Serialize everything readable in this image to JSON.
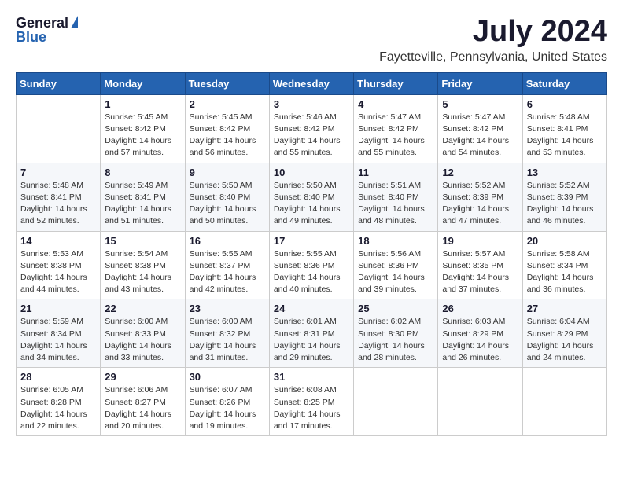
{
  "header": {
    "logo_general": "General",
    "logo_blue": "Blue",
    "month_year": "July 2024",
    "location": "Fayetteville, Pennsylvania, United States"
  },
  "weekdays": [
    "Sunday",
    "Monday",
    "Tuesday",
    "Wednesday",
    "Thursday",
    "Friday",
    "Saturday"
  ],
  "weeks": [
    [
      {
        "day": "",
        "detail": ""
      },
      {
        "day": "1",
        "detail": "Sunrise: 5:45 AM\nSunset: 8:42 PM\nDaylight: 14 hours\nand 57 minutes."
      },
      {
        "day": "2",
        "detail": "Sunrise: 5:45 AM\nSunset: 8:42 PM\nDaylight: 14 hours\nand 56 minutes."
      },
      {
        "day": "3",
        "detail": "Sunrise: 5:46 AM\nSunset: 8:42 PM\nDaylight: 14 hours\nand 55 minutes."
      },
      {
        "day": "4",
        "detail": "Sunrise: 5:47 AM\nSunset: 8:42 PM\nDaylight: 14 hours\nand 55 minutes."
      },
      {
        "day": "5",
        "detail": "Sunrise: 5:47 AM\nSunset: 8:42 PM\nDaylight: 14 hours\nand 54 minutes."
      },
      {
        "day": "6",
        "detail": "Sunrise: 5:48 AM\nSunset: 8:41 PM\nDaylight: 14 hours\nand 53 minutes."
      }
    ],
    [
      {
        "day": "7",
        "detail": "Sunrise: 5:48 AM\nSunset: 8:41 PM\nDaylight: 14 hours\nand 52 minutes."
      },
      {
        "day": "8",
        "detail": "Sunrise: 5:49 AM\nSunset: 8:41 PM\nDaylight: 14 hours\nand 51 minutes."
      },
      {
        "day": "9",
        "detail": "Sunrise: 5:50 AM\nSunset: 8:40 PM\nDaylight: 14 hours\nand 50 minutes."
      },
      {
        "day": "10",
        "detail": "Sunrise: 5:50 AM\nSunset: 8:40 PM\nDaylight: 14 hours\nand 49 minutes."
      },
      {
        "day": "11",
        "detail": "Sunrise: 5:51 AM\nSunset: 8:40 PM\nDaylight: 14 hours\nand 48 minutes."
      },
      {
        "day": "12",
        "detail": "Sunrise: 5:52 AM\nSunset: 8:39 PM\nDaylight: 14 hours\nand 47 minutes."
      },
      {
        "day": "13",
        "detail": "Sunrise: 5:52 AM\nSunset: 8:39 PM\nDaylight: 14 hours\nand 46 minutes."
      }
    ],
    [
      {
        "day": "14",
        "detail": "Sunrise: 5:53 AM\nSunset: 8:38 PM\nDaylight: 14 hours\nand 44 minutes."
      },
      {
        "day": "15",
        "detail": "Sunrise: 5:54 AM\nSunset: 8:38 PM\nDaylight: 14 hours\nand 43 minutes."
      },
      {
        "day": "16",
        "detail": "Sunrise: 5:55 AM\nSunset: 8:37 PM\nDaylight: 14 hours\nand 42 minutes."
      },
      {
        "day": "17",
        "detail": "Sunrise: 5:55 AM\nSunset: 8:36 PM\nDaylight: 14 hours\nand 40 minutes."
      },
      {
        "day": "18",
        "detail": "Sunrise: 5:56 AM\nSunset: 8:36 PM\nDaylight: 14 hours\nand 39 minutes."
      },
      {
        "day": "19",
        "detail": "Sunrise: 5:57 AM\nSunset: 8:35 PM\nDaylight: 14 hours\nand 37 minutes."
      },
      {
        "day": "20",
        "detail": "Sunrise: 5:58 AM\nSunset: 8:34 PM\nDaylight: 14 hours\nand 36 minutes."
      }
    ],
    [
      {
        "day": "21",
        "detail": "Sunrise: 5:59 AM\nSunset: 8:34 PM\nDaylight: 14 hours\nand 34 minutes."
      },
      {
        "day": "22",
        "detail": "Sunrise: 6:00 AM\nSunset: 8:33 PM\nDaylight: 14 hours\nand 33 minutes."
      },
      {
        "day": "23",
        "detail": "Sunrise: 6:00 AM\nSunset: 8:32 PM\nDaylight: 14 hours\nand 31 minutes."
      },
      {
        "day": "24",
        "detail": "Sunrise: 6:01 AM\nSunset: 8:31 PM\nDaylight: 14 hours\nand 29 minutes."
      },
      {
        "day": "25",
        "detail": "Sunrise: 6:02 AM\nSunset: 8:30 PM\nDaylight: 14 hours\nand 28 minutes."
      },
      {
        "day": "26",
        "detail": "Sunrise: 6:03 AM\nSunset: 8:29 PM\nDaylight: 14 hours\nand 26 minutes."
      },
      {
        "day": "27",
        "detail": "Sunrise: 6:04 AM\nSunset: 8:29 PM\nDaylight: 14 hours\nand 24 minutes."
      }
    ],
    [
      {
        "day": "28",
        "detail": "Sunrise: 6:05 AM\nSunset: 8:28 PM\nDaylight: 14 hours\nand 22 minutes."
      },
      {
        "day": "29",
        "detail": "Sunrise: 6:06 AM\nSunset: 8:27 PM\nDaylight: 14 hours\nand 20 minutes."
      },
      {
        "day": "30",
        "detail": "Sunrise: 6:07 AM\nSunset: 8:26 PM\nDaylight: 14 hours\nand 19 minutes."
      },
      {
        "day": "31",
        "detail": "Sunrise: 6:08 AM\nSunset: 8:25 PM\nDaylight: 14 hours\nand 17 minutes."
      },
      {
        "day": "",
        "detail": ""
      },
      {
        "day": "",
        "detail": ""
      },
      {
        "day": "",
        "detail": ""
      }
    ]
  ]
}
